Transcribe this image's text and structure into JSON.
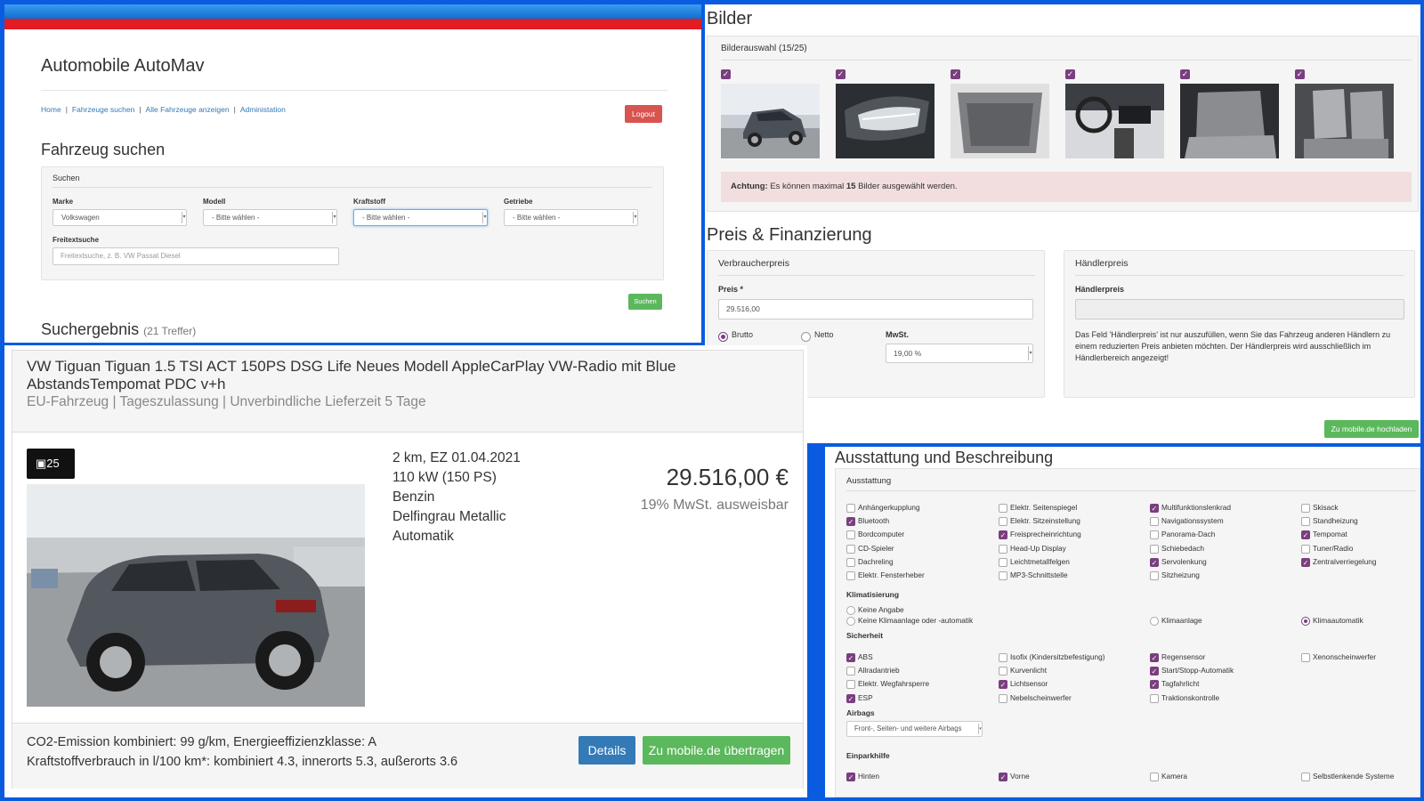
{
  "admin": {
    "app_title": "Automobile AutoMav",
    "nav": [
      "Home",
      "Fahrzeuge suchen",
      "Alle Fahrzeuge anzeigen",
      "Administation"
    ],
    "logout_label": "Logout",
    "search_title": "Fahrzeug suchen",
    "search_legend": "Suchen",
    "fields": [
      {
        "label": "Marke",
        "value": "Volkswagen"
      },
      {
        "label": "Modell",
        "value": "- Bitte wählen -"
      },
      {
        "label": "Kraftstoff",
        "value": "- Bitte wählen -"
      },
      {
        "label": "Getriebe",
        "value": "- Bitte wählen -"
      }
    ],
    "freitext_label": "Freitextsuche",
    "freitext_placeholder": "Freitextsuche, z. B. VW Passat Diesel",
    "search_button": "Suchen",
    "result_title": "Suchergebnis",
    "result_count": "(21 Treffer)"
  },
  "images": {
    "title": "Bilder",
    "selection_label": "Bilderauswahl (15/25)",
    "thumbnails": [
      "car-exterior",
      "headlight",
      "trunk",
      "dashboard",
      "rear-seats",
      "front-seats"
    ],
    "warning_bold": "Achtung:",
    "warning_text_a": "Es können maximal",
    "warning_count": "15",
    "warning_text_b": "Bilder ausgewählt werden."
  },
  "pricing": {
    "title": "Preis & Finanzierung",
    "consumer_legend": "Verbraucherpreis",
    "price_label": "Preis *",
    "price_value": "29.516,00",
    "radio_brutto": "Brutto",
    "radio_netto": "Netto",
    "vat_label": "MwSt.",
    "vat_value": "19,00 %",
    "dealer_legend": "Händlerpreis",
    "dealer_label": "Händlerpreis",
    "dealer_value": "",
    "dealer_help": "Das Feld 'Händlerpreis' ist nur auszufüllen, wenn Sie das Fahrzeug anderen Händlern zu einem reduzierten Preis anbieten möchten. Der Händlerpreis wird ausschließlich im Händlerbereich angezeigt!",
    "upload_button": "Zu mobile.de hochladen"
  },
  "listing": {
    "title_line1": "VW Tiguan Tiguan 1.5 TSI ACT 150PS DSG Life Neues Modell AppleCarPlay VW-Radio mit Blue",
    "title_line2": "AbstandsTempomat PDC v+h",
    "subtitle": "EU-Fahrzeug | Tageszulassung | Unverbindliche Lieferzeit 5 Tage",
    "photo_count": "25",
    "specs": [
      "2 km, EZ 01.04.2021",
      "110 kW (150 PS)",
      "Benzin",
      "Delfingrau Metallic",
      "Automatik"
    ],
    "price": "29.516,00  €",
    "vat_note": "19% MwSt. ausweisbar",
    "co2_line1": "CO2-Emission kombiniert: 99 g/km, Energieeffizienzklasse: A",
    "co2_line2": "Kraftstoffverbrauch in l/100 km*: kombiniert 4.3, innerorts 5.3, außerorts 3.6",
    "details_button": "Details",
    "transfer_button": "Zu mobile.de übertragen"
  },
  "equipment": {
    "title": "Ausstattung und Beschreibung",
    "legend": "Ausstattung",
    "features": [
      {
        "label": "Anhängerkupplung",
        "checked": false
      },
      {
        "label": "Elektr. Seitenspiegel",
        "checked": false
      },
      {
        "label": "Multifunktionslenkrad",
        "checked": true
      },
      {
        "label": "Skisack",
        "checked": false
      },
      {
        "label": "Bluetooth",
        "checked": true
      },
      {
        "label": "Elektr. Sitzeinstellung",
        "checked": false
      },
      {
        "label": "Navigationssystem",
        "checked": false
      },
      {
        "label": "Standheizung",
        "checked": false
      },
      {
        "label": "Bordcomputer",
        "checked": false
      },
      {
        "label": "Freisprecheinrichtung",
        "checked": true
      },
      {
        "label": "Panorama-Dach",
        "checked": false
      },
      {
        "label": "Tempomat",
        "checked": true
      },
      {
        "label": "CD-Spieler",
        "checked": false
      },
      {
        "label": "Head-Up Display",
        "checked": false
      },
      {
        "label": "Schiebedach",
        "checked": false
      },
      {
        "label": "Tuner/Radio",
        "checked": false
      },
      {
        "label": "Dachreling",
        "checked": false
      },
      {
        "label": "Leichtmetallfelgen",
        "checked": false
      },
      {
        "label": "Servolenkung",
        "checked": true
      },
      {
        "label": "Zentralverriegelung",
        "checked": true
      },
      {
        "label": "Elektr. Fensterheber",
        "checked": false
      },
      {
        "label": "MP3-Schnittstelle",
        "checked": false
      },
      {
        "label": "Sitzheizung",
        "checked": false
      }
    ],
    "climate_title": "Klimatisierung",
    "climate": [
      {
        "label": "Keine Angabe",
        "checked": false
      },
      {
        "label": "Keine Klimaanlage oder -automatik",
        "checked": false
      },
      {
        "label": "Klimaanlage",
        "checked": false
      },
      {
        "label": "Klimaautomatik",
        "checked": true
      }
    ],
    "safety_title": "Sicherheit",
    "safety": [
      {
        "label": "ABS",
        "checked": true
      },
      {
        "label": "Isofix (Kindersitzbefestigung)",
        "checked": false
      },
      {
        "label": "Regensensor",
        "checked": true
      },
      {
        "label": "Xenonscheinwerfer",
        "checked": false
      },
      {
        "label": "Allradantrieb",
        "checked": false
      },
      {
        "label": "Kurvenlicht",
        "checked": false
      },
      {
        "label": "Start/Stopp-Automatik",
        "checked": true
      },
      {
        "label": "Elektr. Wegfahrsperre",
        "checked": false
      },
      {
        "label": "Lichtsensor",
        "checked": true
      },
      {
        "label": "Tagfahrlicht",
        "checked": true
      },
      {
        "label": "ESP",
        "checked": true
      },
      {
        "label": "Nebelscheinwerfer",
        "checked": false
      },
      {
        "label": "Traktionskontrolle",
        "checked": false
      }
    ],
    "airbags_title": "Airbags",
    "airbags_value": "Front-, Seiten- und weitere Airbags",
    "parking_title": "Einparkhilfe",
    "parking": [
      {
        "label": "Hinten",
        "checked": true
      },
      {
        "label": "Vorne",
        "checked": true
      },
      {
        "label": "Kamera",
        "checked": false
      },
      {
        "label": "Selbstlenkende Systeme",
        "checked": false
      }
    ]
  },
  "colors": {
    "accent": "#7a3f7e",
    "success": "#5cb85c",
    "primary": "#337ab7",
    "danger": "#d9534f",
    "frame": "#0a5be0"
  }
}
